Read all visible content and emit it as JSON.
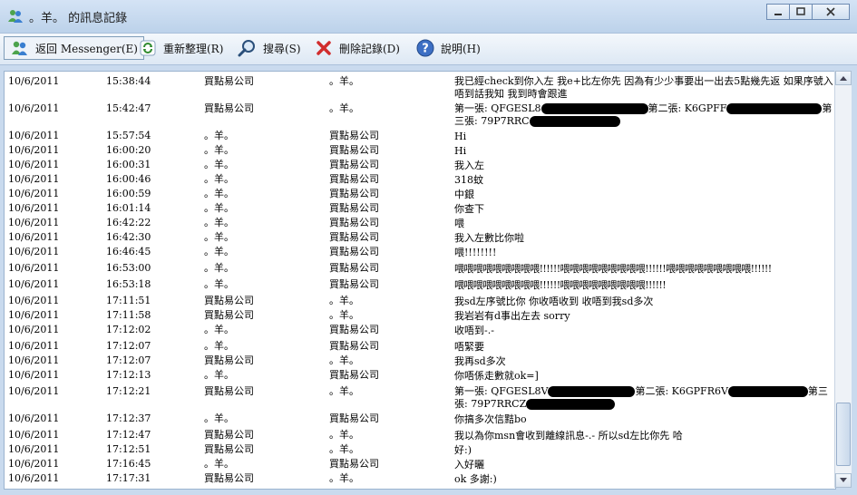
{
  "window": {
    "title": "。羊。 的訊息記錄"
  },
  "toolbar": {
    "back_label": "返回 Messenger(E)",
    "reorganize_label": "重新整理(R)",
    "search_label": "搜尋(S)",
    "delete_label": "刪除記錄(D)",
    "help_label": "說明(H)"
  },
  "messages": [
    {
      "date": "10/6/2011",
      "time": "15:38:44",
      "from": "買點易公司",
      "to": "。羊。",
      "msg": "我已經check到你入左 我e+比左你先 因為有少少事要出一出去5點幾先返 如果序號入唔到話我知 我到時會跟進"
    },
    {
      "date": "10/6/2011",
      "time": "15:42:47",
      "from": "買點易公司",
      "to": "。羊。",
      "msg_a": "第一張: QFGESL8",
      "msg_b": "第二張: K6GPFF",
      "msg_c": "第三張: 79P7RRC"
    },
    {
      "date": "10/6/2011",
      "time": "15:57:54",
      "from": "。羊。",
      "to": "買點易公司",
      "msg": "Hi"
    },
    {
      "date": "10/6/2011",
      "time": "16:00:20",
      "from": "。羊。",
      "to": "買點易公司",
      "msg": "Hi"
    },
    {
      "date": "10/6/2011",
      "time": "16:00:31",
      "from": "。羊。",
      "to": "買點易公司",
      "msg": "我入左"
    },
    {
      "date": "10/6/2011",
      "time": "16:00:46",
      "from": "。羊。",
      "to": "買點易公司",
      "msg": "318蚊"
    },
    {
      "date": "10/6/2011",
      "time": "16:00:59",
      "from": "。羊。",
      "to": "買點易公司",
      "msg": "中銀"
    },
    {
      "date": "10/6/2011",
      "time": "16:01:14",
      "from": "。羊。",
      "to": "買點易公司",
      "msg": "你查下"
    },
    {
      "date": "10/6/2011",
      "time": "16:42:22",
      "from": "。羊。",
      "to": "買點易公司",
      "msg": "喂"
    },
    {
      "date": "10/6/2011",
      "time": "16:42:30",
      "from": "。羊。",
      "to": "買點易公司",
      "msg": "我入左數比你啦"
    },
    {
      "date": "10/6/2011",
      "time": "16:46:45",
      "from": "。羊。",
      "to": "買點易公司",
      "msg": "喂!!!!!!!!"
    },
    {
      "date": "10/6/2011",
      "time": "16:53:00",
      "from": "。羊。",
      "to": "買點易公司",
      "msg": "喂喂喂喂喂喂喂喂喂!!!!!!喂喂喂喂喂喂喂喂喂!!!!!!喂喂喂喂喂喂喂喂喂!!!!!!"
    },
    {
      "date": "10/6/2011",
      "time": "16:53:18",
      "from": "。羊。",
      "to": "買點易公司",
      "msg": "喂喂喂喂喂喂喂喂喂!!!!!!喂喂喂喂喂喂喂喂喂!!!!!!"
    },
    {
      "date": "10/6/2011",
      "time": "17:11:51",
      "from": "買點易公司",
      "to": "。羊。",
      "msg": "我sd左序號比你 你收唔收到 收唔到我sd多次"
    },
    {
      "date": "10/6/2011",
      "time": "17:11:58",
      "from": "買點易公司",
      "to": "。羊。",
      "msg": "我岩岩有d事出左去 sorry"
    },
    {
      "date": "10/6/2011",
      "time": "17:12:02",
      "from": "。羊。",
      "to": "買點易公司",
      "msg": "收唔到-.-"
    },
    {
      "date": "10/6/2011",
      "time": "17:12:07",
      "from": "。羊。",
      "to": "買點易公司",
      "msg": "唔緊要"
    },
    {
      "date": "10/6/2011",
      "time": "17:12:07",
      "from": "買點易公司",
      "to": "。羊。",
      "msg": "我再sd多次"
    },
    {
      "date": "10/6/2011",
      "time": "17:12:13",
      "from": "。羊。",
      "to": "買點易公司",
      "msg": "你唔係走數就ok=]"
    },
    {
      "date": "10/6/2011",
      "time": "17:12:21",
      "from": "買點易公司",
      "to": "。羊。",
      "msg_a": "第一張: QFGESL8V",
      "msg_b": "第二張: K6GPFR6V",
      "msg_c": "第三張: 79P7RRCZ"
    },
    {
      "date": "10/6/2011",
      "time": "17:12:37",
      "from": "。羊。",
      "to": "買點易公司",
      "msg": "你搞多次信黠bo"
    },
    {
      "date": "10/6/2011",
      "time": "17:12:47",
      "from": "買點易公司",
      "to": "。羊。",
      "msg": "我以為你msn會收到離線訊息-.- 所以sd左比你先 哈"
    },
    {
      "date": "10/6/2011",
      "time": "17:12:51",
      "from": "買點易公司",
      "to": "。羊。",
      "msg": "好:)"
    },
    {
      "date": "10/6/2011",
      "time": "17:16:45",
      "from": "。羊。",
      "to": "買點易公司",
      "msg": "入好曬"
    },
    {
      "date": "10/6/2011",
      "time": "17:17:31",
      "from": "買點易公司",
      "to": "。羊。",
      "msg": "ok 多謝:)"
    }
  ],
  "colors": {
    "title_bg": "#c7d9ee",
    "content_bg": "#ffffff"
  }
}
